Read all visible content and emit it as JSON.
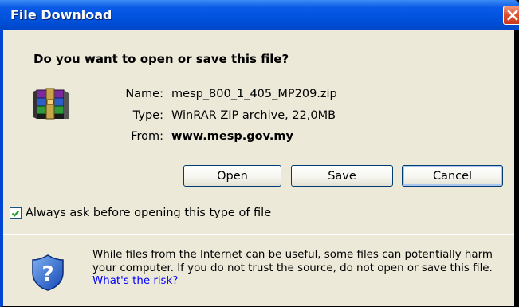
{
  "window": {
    "title": "File Download"
  },
  "dialog": {
    "question": "Do you want to open or save this file?",
    "fields": [
      {
        "label": "Name:",
        "value": "mesp_800_1_405_MP209.zip"
      },
      {
        "label": "Type:",
        "value": "WinRAR ZIP archive, 22,0MB"
      },
      {
        "label": "From:",
        "value": "www.mesp.gov.my"
      }
    ],
    "buttons": {
      "open": "Open",
      "save": "Save",
      "cancel": "Cancel"
    },
    "checkbox": {
      "label": "Always ask before opening this type of file",
      "checked": true
    },
    "warning": {
      "text": "While files from the Internet can be useful, some files can potentially harm your computer. If you do not trust the source, do not open or save this file.",
      "link": "What's the risk?"
    },
    "icons": {
      "file": "winrar-archive-icon",
      "warning": "shield-question-icon",
      "close": "close-icon"
    }
  }
}
